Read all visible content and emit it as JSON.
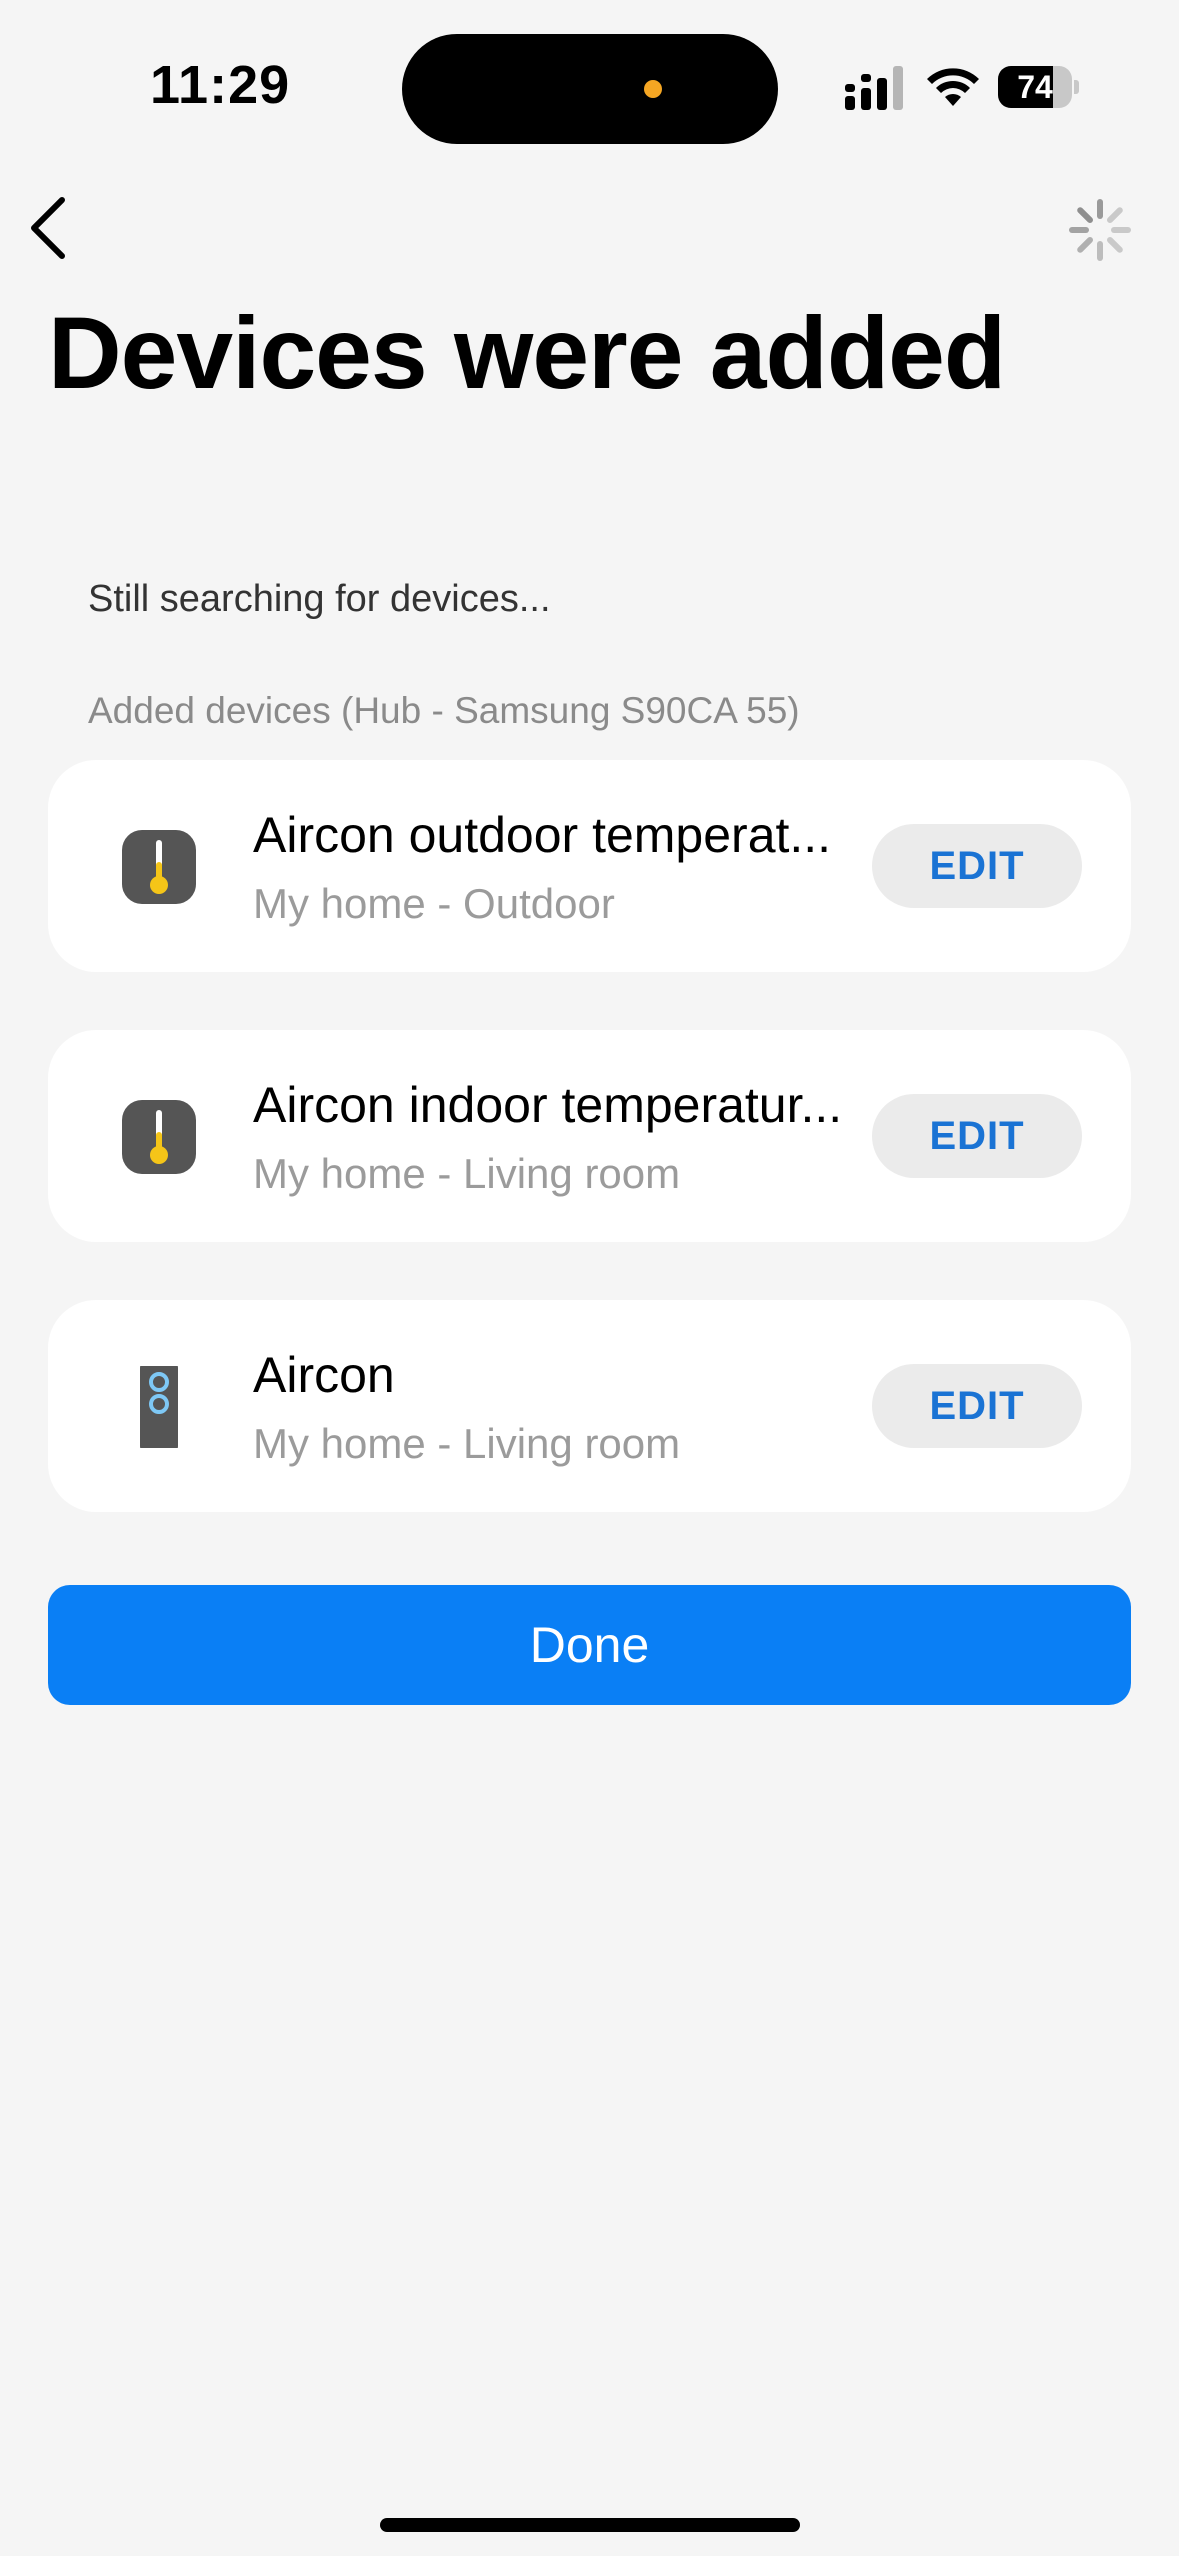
{
  "status_bar": {
    "time": "11:29",
    "battery_level": "74",
    "battery_fraction": 0.74,
    "icons": [
      "signal-icon",
      "wifi-icon",
      "battery-icon"
    ]
  },
  "nav": {
    "back_icon": "chevron-left-icon",
    "loading_icon": "spinner-icon"
  },
  "title": "Devices were added",
  "searching_text": "Still searching for devices...",
  "section_label": "Added devices (Hub - Samsung S90CA 55)",
  "devices": [
    {
      "name": "Aircon outdoor temperat...",
      "location": "My home - Outdoor",
      "icon": "thermometer-icon",
      "edit_label": "EDIT"
    },
    {
      "name": "Aircon indoor temperatur...",
      "location": "My home - Living room",
      "icon": "thermometer-icon",
      "edit_label": "EDIT"
    },
    {
      "name": "Aircon",
      "location": "My home - Living room",
      "icon": "remote-control-icon",
      "edit_label": "EDIT"
    }
  ],
  "done_label": "Done",
  "colors": {
    "accent": "#0a7ff5",
    "edit_text": "#1a73d4",
    "background": "#f5f5f5",
    "indicator": "#f5a623"
  }
}
